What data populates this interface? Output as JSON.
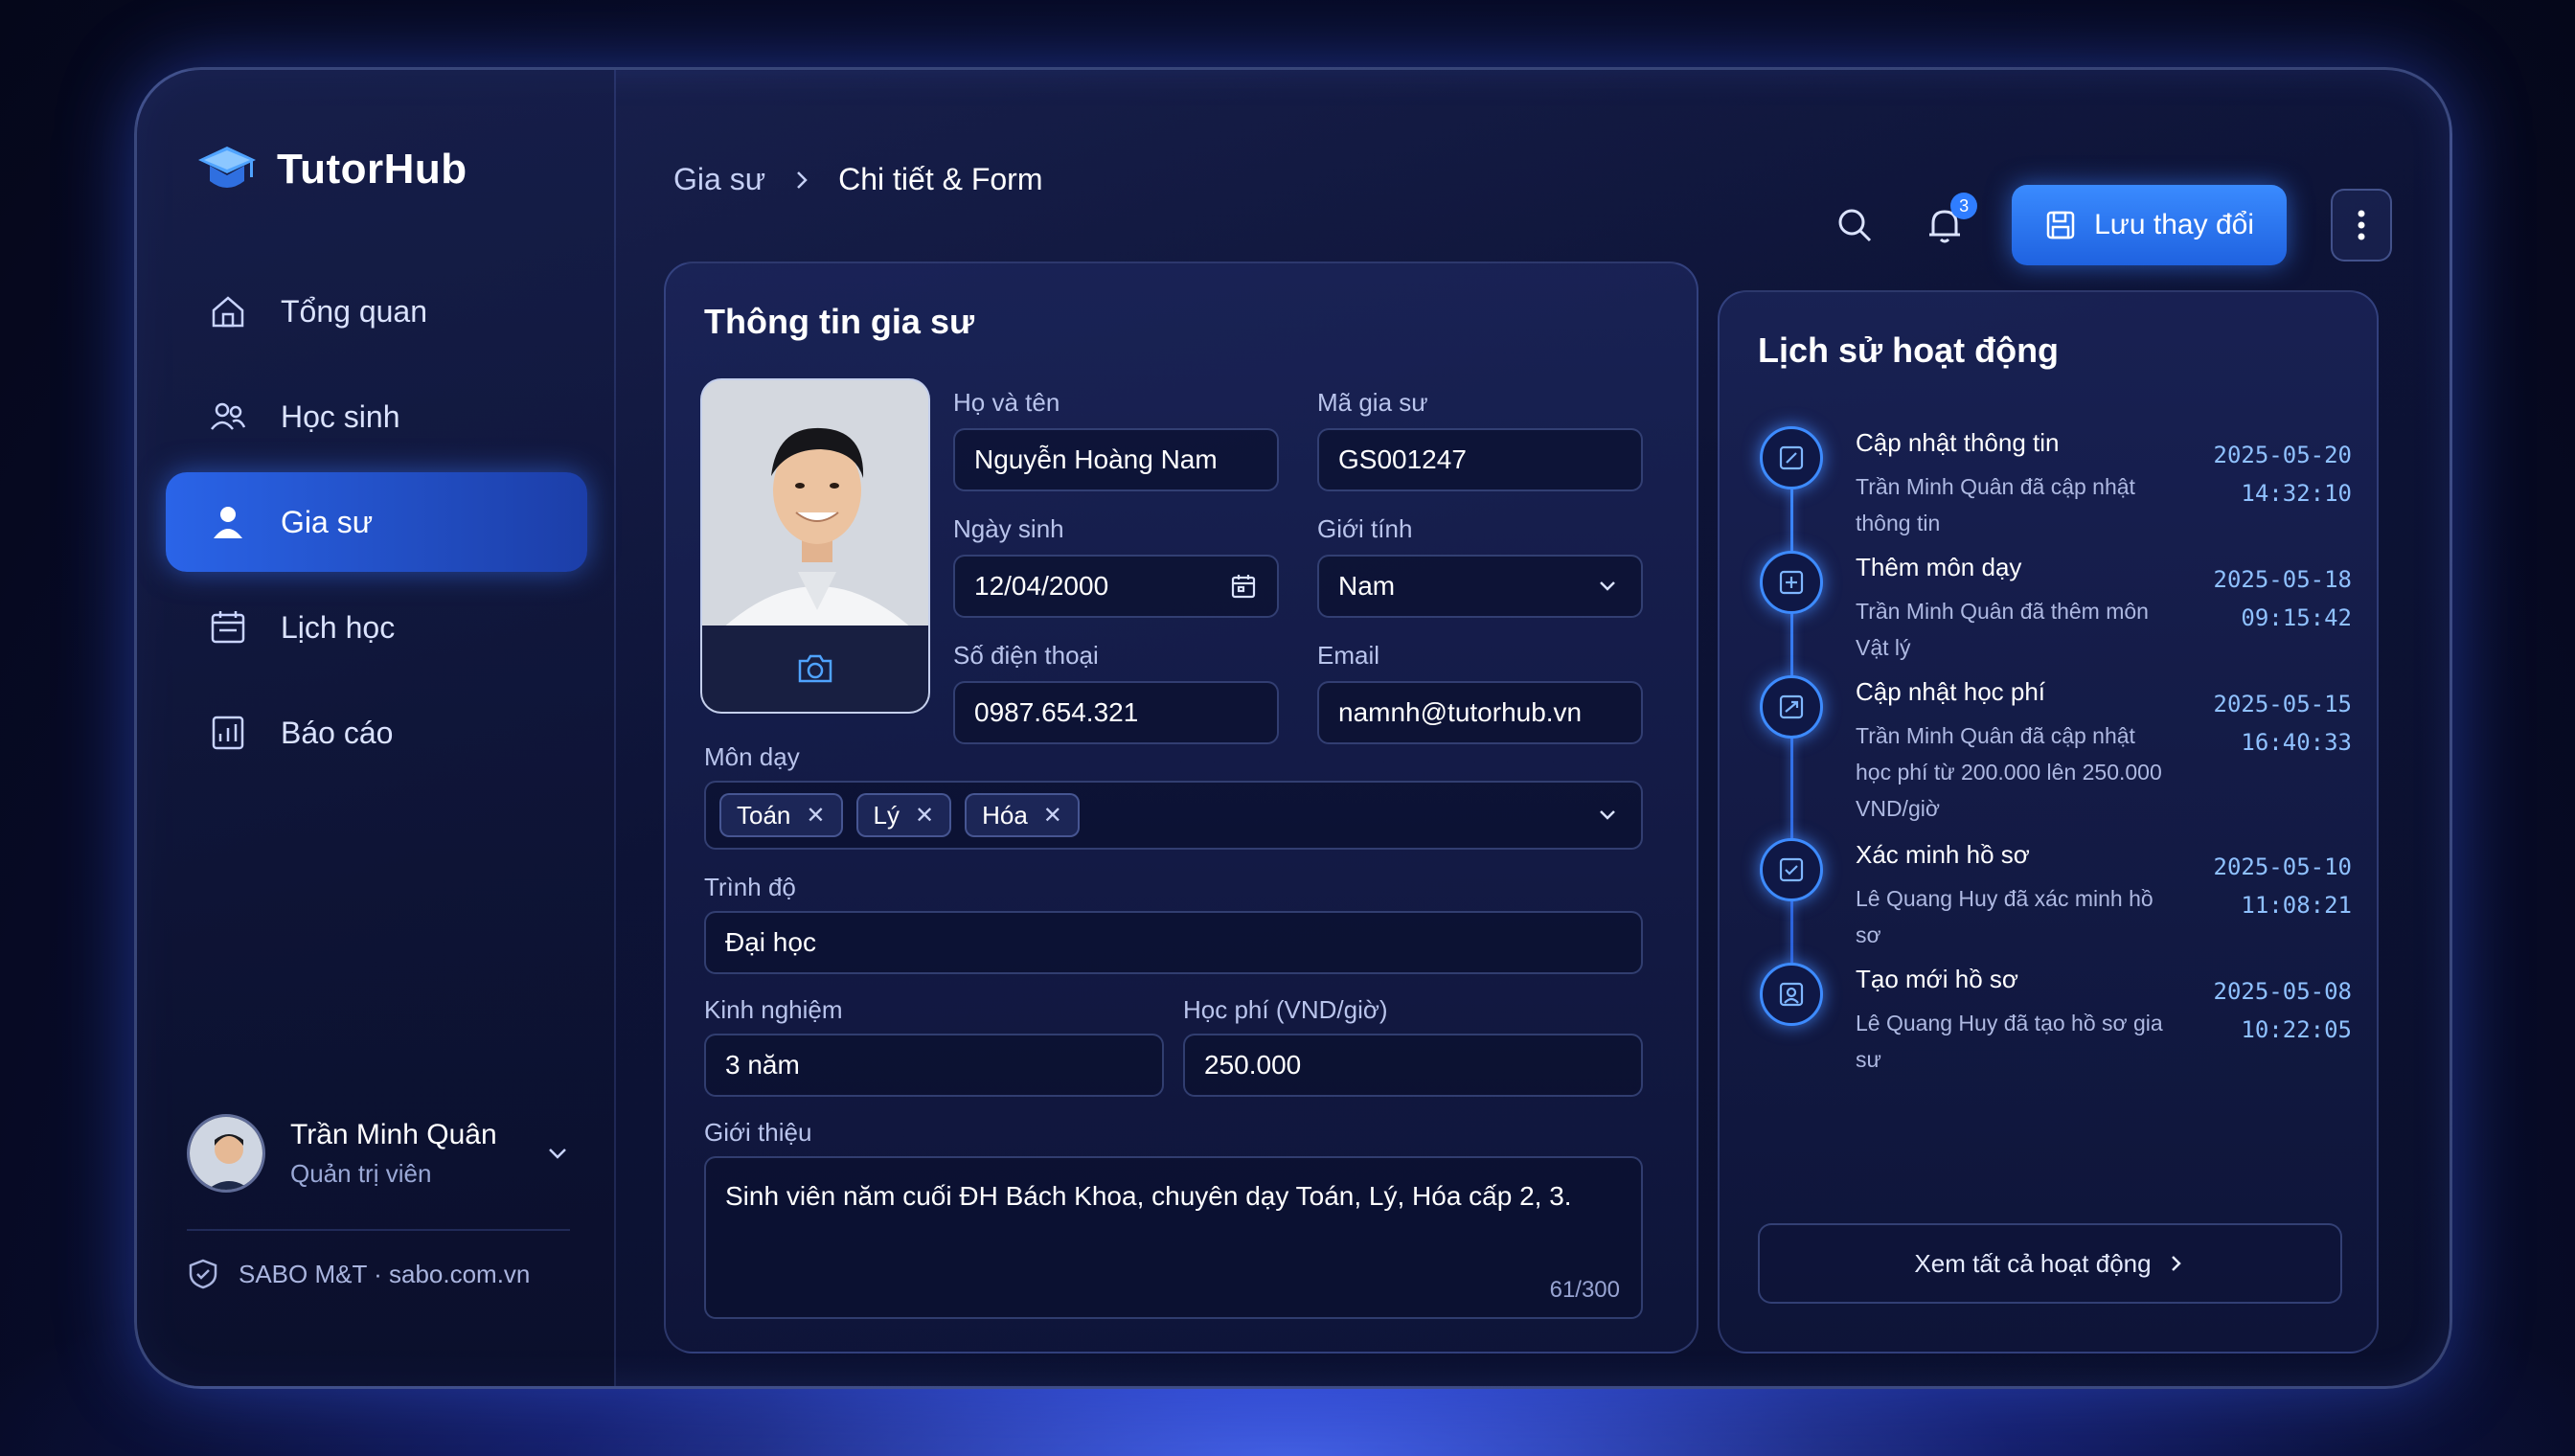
{
  "app": {
    "name": "TutorHub"
  },
  "sidebar": {
    "items": [
      {
        "label": "Tổng quan",
        "icon": "home-icon",
        "active": false
      },
      {
        "label": "Học sinh",
        "icon": "students-icon",
        "active": false
      },
      {
        "label": "Gia sư",
        "icon": "user-icon",
        "active": true
      },
      {
        "label": "Lịch học",
        "icon": "calendar-icon",
        "active": false
      },
      {
        "label": "Báo cáo",
        "icon": "report-icon",
        "active": false
      }
    ],
    "user": {
      "name": "Trần Minh Quân",
      "role": "Quản trị viên"
    },
    "footer": "SABO M&T · sabo.com.vn"
  },
  "breadcrumb": {
    "parent": "Gia sư",
    "current": "Chi tiết & Form"
  },
  "topbar": {
    "notifications": "3",
    "save_label": "Lưu thay đổi"
  },
  "form": {
    "title": "Thông tin gia sư",
    "full_name": {
      "label": "Họ và tên",
      "value": "Nguyễn Hoàng Nam"
    },
    "tutor_id": {
      "label": "Mã gia sư",
      "value": "GS001247"
    },
    "dob": {
      "label": "Ngày sinh",
      "value": "12/04/2000"
    },
    "gender": {
      "label": "Giới tính",
      "value": "Nam"
    },
    "phone": {
      "label": "Số điện thoại",
      "value": "0987.654.321"
    },
    "email": {
      "label": "Email",
      "value": "namnh@tutorhub.vn"
    },
    "subjects": {
      "label": "Môn dạy",
      "values": [
        "Toán",
        "Lý",
        "Hóa"
      ]
    },
    "level": {
      "label": "Trình độ",
      "value": "Đại học"
    },
    "experience": {
      "label": "Kinh nghiệm",
      "value": "3 năm"
    },
    "fee": {
      "label": "Học phí (VND/giờ)",
      "value": "250.000"
    },
    "intro": {
      "label": "Giới thiệu",
      "value": "Sinh viên năm cuối ĐH Bách Khoa, chuyên dạy Toán, Lý, Hóa cấp 2, 3.",
      "counter": "61/300"
    }
  },
  "history": {
    "title": "Lịch sử hoạt động",
    "items": [
      {
        "title": "Cập nhật thông tin",
        "desc": "Trần Minh Quân đã cập nhật thông tin",
        "date": "2025-05-20",
        "time": "14:32:10"
      },
      {
        "title": "Thêm môn dạy",
        "desc": "Trần Minh Quân đã thêm môn Vật lý",
        "date": "2025-05-18",
        "time": "09:15:42"
      },
      {
        "title": "Cập nhật học phí",
        "desc": "Trần Minh Quân đã cập nhật học phí từ 200.000 lên 250.000 VND/giờ",
        "date": "2025-05-15",
        "time": "16:40:33"
      },
      {
        "title": "Xác minh hồ sơ",
        "desc": "Lê Quang Huy đã xác minh hồ sơ",
        "date": "2025-05-10",
        "time": "11:08:21"
      },
      {
        "title": "Tạo mới hồ sơ",
        "desc": "Lê Quang Huy đã tạo hồ sơ gia sư",
        "date": "2025-05-08",
        "time": "10:22:05"
      }
    ],
    "view_all": "Xem tất cả hoạt động"
  },
  "colors": {
    "accent": "#2f7dff",
    "background": "#080c2a",
    "panel": "#1c265c"
  }
}
